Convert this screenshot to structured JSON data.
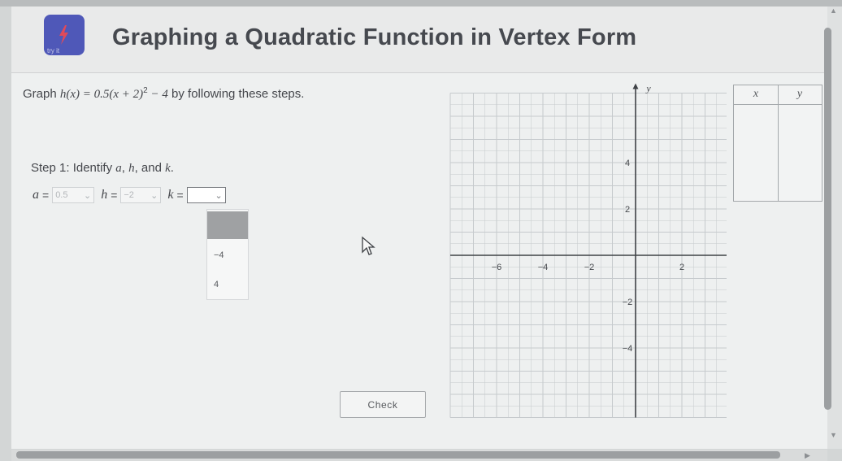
{
  "header": {
    "title": "Graphing a Quadratic Function in Vertex Form",
    "logo_caption": "try it"
  },
  "instruction": {
    "prefix": "Graph ",
    "function": "h(x) = 0.5(x + 2)",
    "exponent": "2",
    "tail": " − 4",
    "suffix": " by following these steps."
  },
  "step1": {
    "label_prefix": "Step 1: Identify ",
    "var_a": "a",
    "sep1": ", ",
    "var_h": "h",
    "sep2": ", and ",
    "var_k": "k",
    "end": "."
  },
  "answers": {
    "a_label": "a",
    "a_value": "0.5",
    "h_label": "h",
    "h_value": "−2",
    "k_label": "k",
    "k_value": "",
    "equals": "="
  },
  "dropdown": {
    "options": [
      "",
      "−4",
      "4"
    ]
  },
  "check_button": "Check",
  "graph": {
    "x_axis_label": "x",
    "y_axis_label": "y",
    "x_ticks": [
      "−6",
      "−4",
      "−2",
      "2"
    ],
    "y_ticks": [
      "4",
      "2",
      "−2",
      "−4"
    ]
  },
  "table": {
    "col_x": "x",
    "col_y": "y"
  },
  "colors": {
    "logo": "#4f58b8",
    "grid": "#c6cacd",
    "axis": "#3f4246"
  }
}
